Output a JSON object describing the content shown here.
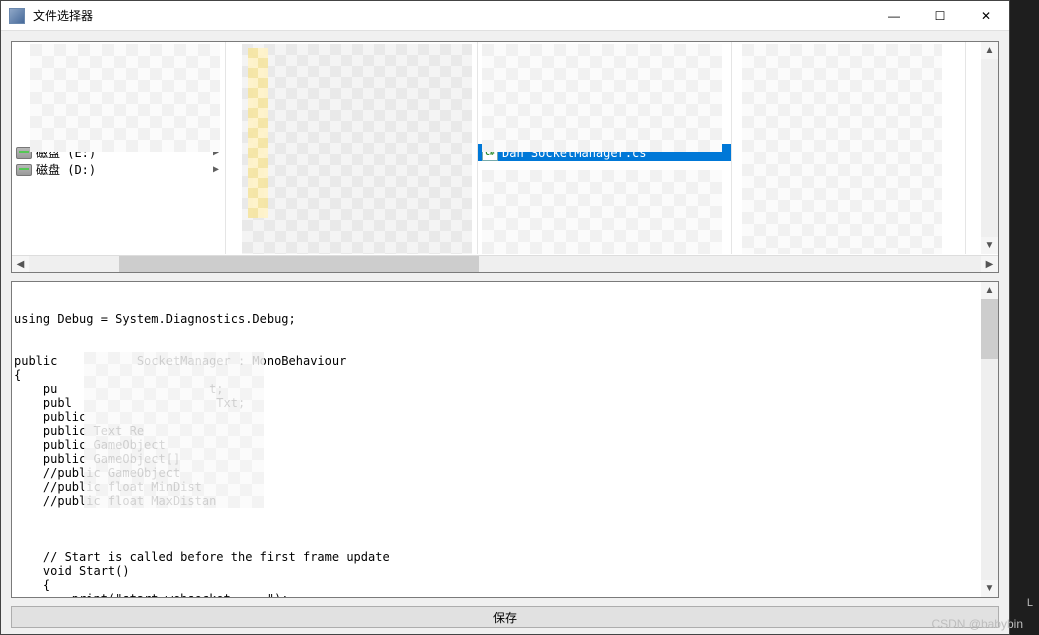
{
  "window": {
    "title": "文件选择器",
    "minimize_glyph": "—",
    "maximize_glyph": "☐",
    "close_glyph": "✕"
  },
  "drives": {
    "items": [
      {
        "label": "",
        "has_children": true,
        "masked": true
      },
      {
        "label": "",
        "has_children": true,
        "masked": true
      },
      {
        "label": "",
        "has_children": true,
        "masked": true
      },
      {
        "label": "",
        "has_children": true,
        "masked": true
      },
      {
        "label": "",
        "has_children": true,
        "masked": true
      },
      {
        "label": "",
        "has_children": true,
        "masked": true
      },
      {
        "label": "磁盘 (E:)",
        "has_children": true,
        "masked": false,
        "icon": "drive"
      },
      {
        "label": "磁盘 (D:)",
        "has_children": true,
        "masked": false,
        "icon": "drive"
      }
    ]
  },
  "col2_items": [
    {
      "label": "",
      "has_children": true,
      "masked": true
    },
    {
      "label": "",
      "has_children": true,
      "masked": true
    },
    {
      "label": "",
      "has_children": true,
      "masked": true
    },
    {
      "label": "",
      "has_children": true,
      "masked": true
    },
    {
      "label": "",
      "has_children": true,
      "masked": true
    },
    {
      "label": "",
      "has_children": true,
      "masked": true
    },
    {
      "label": "",
      "has_children": true,
      "masked": true
    },
    {
      "label": "",
      "has_children": true,
      "masked": true
    },
    {
      "label": "",
      "has_children": true,
      "masked": true
    },
    {
      "label": "",
      "has_children": true,
      "masked": true
    },
    {
      "label": "",
      "has_children": true,
      "masked": true
    },
    {
      "label": "",
      "has_children": true,
      "masked": true
    }
  ],
  "col3_items": [
    {
      "label": "",
      "has_children": true,
      "masked": true
    },
    {
      "label": "",
      "has_children": true,
      "masked": true
    },
    {
      "label": "",
      "has_children": true,
      "masked": true
    },
    {
      "label": "",
      "has_children": true,
      "masked": true
    },
    {
      "label": "",
      "has_children": true,
      "masked": true
    },
    {
      "label": "",
      "has_children": true,
      "masked": true
    },
    {
      "label": "Dan  SocketManager.cs",
      "has_children": false,
      "masked": false,
      "selected": true,
      "icon": "code"
    },
    {
      "label": "",
      "has_children": true,
      "masked": true
    },
    {
      "label": "",
      "has_children": true,
      "masked": true
    },
    {
      "label": "",
      "has_children": true,
      "masked": true
    },
    {
      "label": "",
      "has_children": true,
      "masked": true
    },
    {
      "label": "",
      "has_children": true,
      "masked": true
    }
  ],
  "col4_items": [
    {
      "label": "",
      "has_children": false,
      "masked": true
    },
    {
      "label": "",
      "has_children": false,
      "masked": true
    }
  ],
  "preview": {
    "text": "using Debug = System.Diagnostics.Debug;\n\n\npublic           SocketManager : MonoBehaviour\n{\n    pu                     t;\n    publ                    Txt;\n    public  \n    public Text Re\n    public GameObject\n    public GameObject[]\n    //public GameObject \n    //public float MinDist\n    //public float MaxDistan\n\n\n\n    // Start is called before the first frame update\n    void Start()\n    {\n        print(\"start websocket.....\");"
  },
  "save": {
    "label": "保存"
  },
  "watermark": "CSDN @babybin"
}
